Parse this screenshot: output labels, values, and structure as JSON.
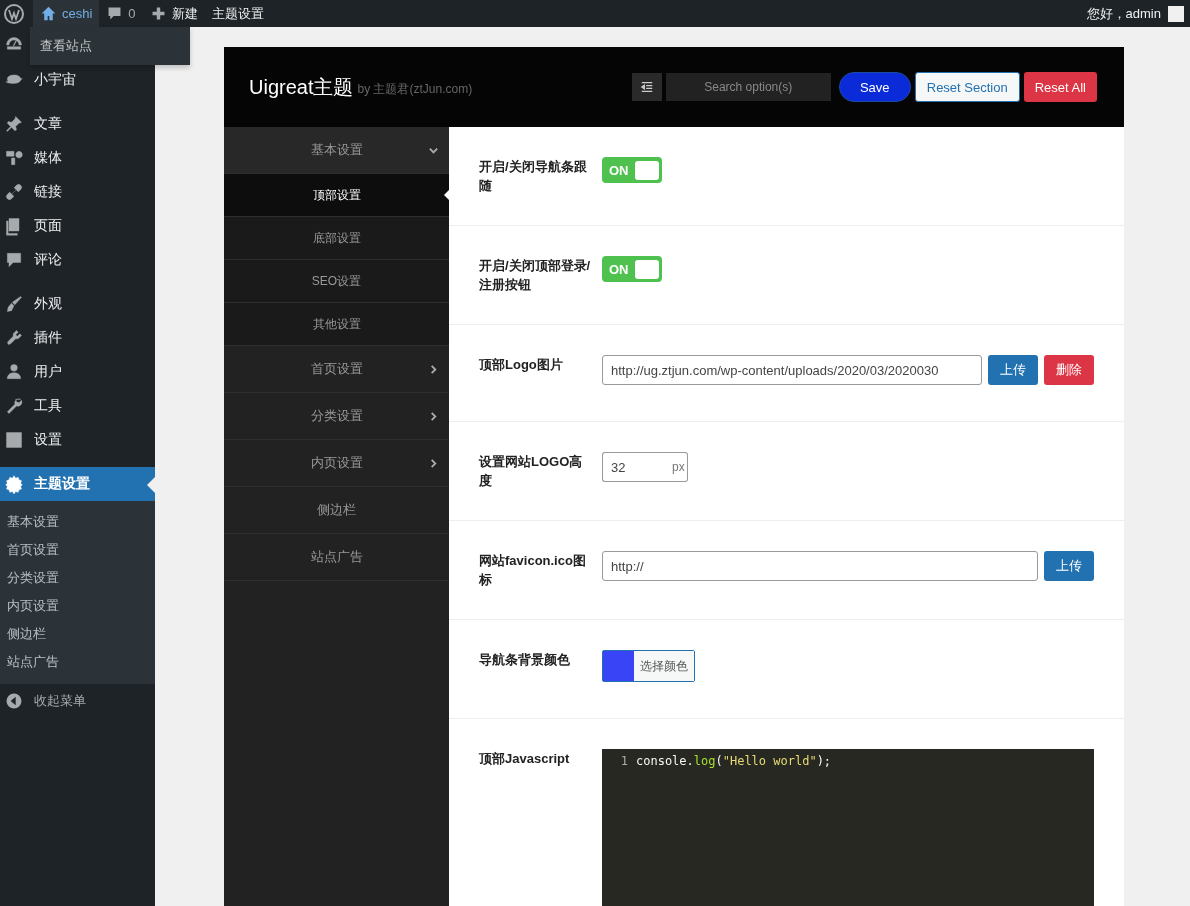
{
  "admin_bar": {
    "site_name": "ceshi",
    "comments_count": "0",
    "new_label": "新建",
    "theme_settings_label": "主题设置",
    "greeting": "您好，admin",
    "dropdown_item": "查看站点"
  },
  "sidebar": {
    "groups": [
      [
        {
          "selected": false
        },
        {
          "label": "小宇宙",
          "selected": false
        }
      ],
      [
        {
          "label": "文章",
          "selected": false
        },
        {
          "label": "媒体",
          "selected": false
        },
        {
          "label": "链接",
          "selected": false
        },
        {
          "label": "页面",
          "selected": false
        },
        {
          "label": "评论",
          "selected": false
        }
      ],
      [
        {
          "label": "外观",
          "selected": false
        },
        {
          "label": "插件",
          "selected": false
        },
        {
          "label": "用户",
          "selected": false
        },
        {
          "label": "工具",
          "selected": false
        },
        {
          "label": "设置",
          "selected": false
        }
      ],
      [
        {
          "label": "主题设置",
          "selected": true,
          "children": [
            {
              "label": "基本设置",
              "selected": false
            },
            {
              "label": "首页设置",
              "selected": false
            },
            {
              "label": "分类设置",
              "selected": false
            },
            {
              "label": "内页设置",
              "selected": false
            },
            {
              "label": "侧边栏",
              "selected": false
            },
            {
              "label": "站点广告",
              "selected": false
            }
          ]
        }
      ]
    ],
    "collapse_label": "收起菜单"
  },
  "panel": {
    "title": "Uigreat主题",
    "byline": "by 主题君(ztJun.com)",
    "search": {
      "placeholder": "Search option(s)"
    },
    "buttons": [
      {
        "label": "Save",
        "kind": "primary"
      },
      {
        "label": "Reset Section",
        "kind": "outline"
      },
      {
        "label": "Reset All",
        "kind": "danger"
      }
    ],
    "nav": [
      {
        "label": "基本设置",
        "kind": "group",
        "expanded": true,
        "children": [
          {
            "label": "顶部设置",
            "selected": true
          },
          {
            "label": "底部设置",
            "selected": false
          },
          {
            "label": "SEO设置",
            "selected": false
          },
          {
            "label": "其他设置",
            "selected": false
          }
        ]
      },
      {
        "label": "首页设置",
        "kind": "group",
        "expanded": false
      },
      {
        "label": "分类设置",
        "kind": "group",
        "expanded": false
      },
      {
        "label": "内页设置",
        "kind": "group",
        "expanded": false
      },
      {
        "label": "侧边栏",
        "kind": "link"
      },
      {
        "label": "站点广告",
        "kind": "link"
      }
    ],
    "fields": [
      {
        "kind": "switch",
        "label": "开启/关闭导航条跟随",
        "on": true,
        "on_text": "ON"
      },
      {
        "kind": "switch",
        "label": "开启/关闭顶部登录/注册按钮",
        "on": true,
        "on_text": "ON"
      },
      {
        "kind": "upload",
        "label": "顶部Logo图片",
        "value": "http://ug.ztjun.com/wp-content/uploads/2020/03/2020030",
        "buttons": [
          {
            "label": "上传",
            "kind": "upload"
          },
          {
            "label": "删除",
            "kind": "delete"
          }
        ]
      },
      {
        "kind": "number",
        "label": "设置网站LOGO高度",
        "value": "32",
        "unit": "px"
      },
      {
        "kind": "upload",
        "label": "网站favicon.ico图标",
        "value": "http://",
        "buttons": [
          {
            "label": "上传",
            "kind": "upload"
          }
        ]
      },
      {
        "kind": "color",
        "label": "导航条背景颜色",
        "color": "#3a44f7",
        "button_label": "选择颜色"
      },
      {
        "kind": "code",
        "label": "顶部Javascript",
        "lines": [
          {
            "number": "1",
            "tokens": [
              {
                "text": "console.",
                "kind": "plain"
              },
              {
                "text": "log",
                "kind": "function"
              },
              {
                "text": "(",
                "kind": "plain"
              },
              {
                "text": "\"Hello world\"",
                "kind": "string"
              },
              {
                "text": ");",
                "kind": "plain"
              }
            ]
          }
        ]
      }
    ]
  }
}
